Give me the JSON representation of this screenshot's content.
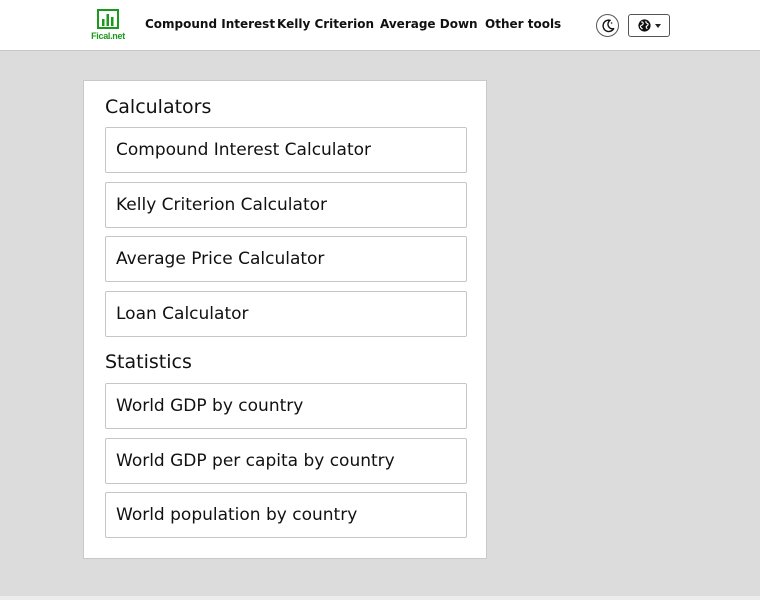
{
  "brand": {
    "name": "Fical.net",
    "color": "#1a9a1a"
  },
  "nav": {
    "links": [
      {
        "label": "Compound Interest"
      },
      {
        "label": "Kelly Criterion"
      },
      {
        "label": "Average Down"
      },
      {
        "label": "Other tools"
      }
    ],
    "theme_toggle_icon": "moon-icon",
    "language_icon": "globe-icon"
  },
  "sections": [
    {
      "title": "Calculators",
      "items": [
        {
          "label": "Compound Interest Calculator"
        },
        {
          "label": "Kelly Criterion Calculator"
        },
        {
          "label": "Average Price Calculator"
        },
        {
          "label": "Loan Calculator"
        }
      ]
    },
    {
      "title": "Statistics",
      "items": [
        {
          "label": "World GDP by country"
        },
        {
          "label": "World GDP per capita by country"
        },
        {
          "label": "World population by country"
        }
      ]
    }
  ]
}
